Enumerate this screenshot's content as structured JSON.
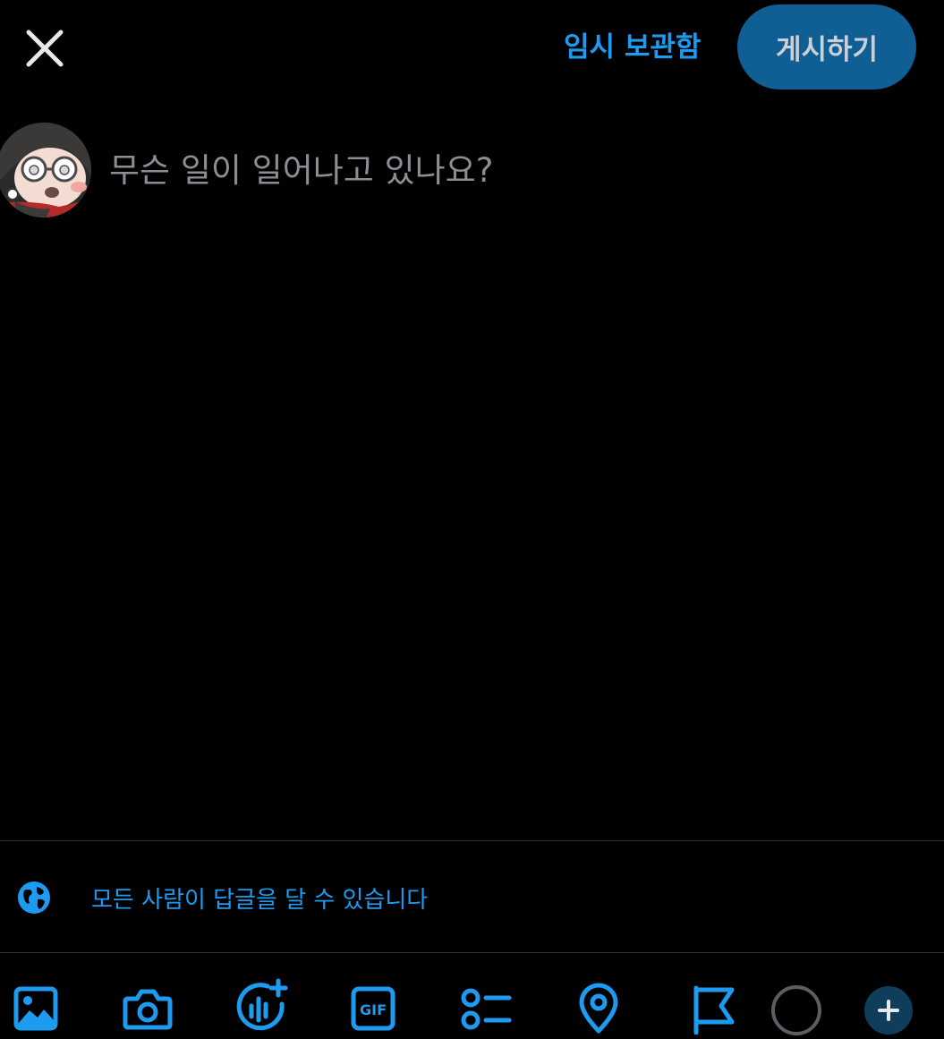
{
  "header": {
    "close_icon": "close-icon",
    "drafts_label": "임시 보관함",
    "post_label": "게시하기"
  },
  "compose": {
    "placeholder": "무슨 일이 일어나고 있나요?",
    "value": ""
  },
  "reply_setting": {
    "icon": "globe-icon",
    "label": "모든 사람이 답글을 달 수 있습니다"
  },
  "toolbar": {
    "items": [
      {
        "icon": "image-icon"
      },
      {
        "icon": "camera-icon"
      },
      {
        "icon": "voice-space-icon"
      },
      {
        "icon": "gif-icon",
        "label": "GIF"
      },
      {
        "icon": "poll-icon"
      },
      {
        "icon": "location-icon"
      },
      {
        "icon": "flag-icon"
      },
      {
        "icon": "character-counter-icon"
      },
      {
        "icon": "add-thread-icon"
      }
    ]
  },
  "colors": {
    "background": "#000000",
    "accent": "#1d9bf0",
    "post_button_bg": "#0f5e94",
    "post_button_text": "#c9d1d7",
    "placeholder": "#8b8f93",
    "divider": "#2f3336",
    "counter_ring": "#5b5f63"
  }
}
